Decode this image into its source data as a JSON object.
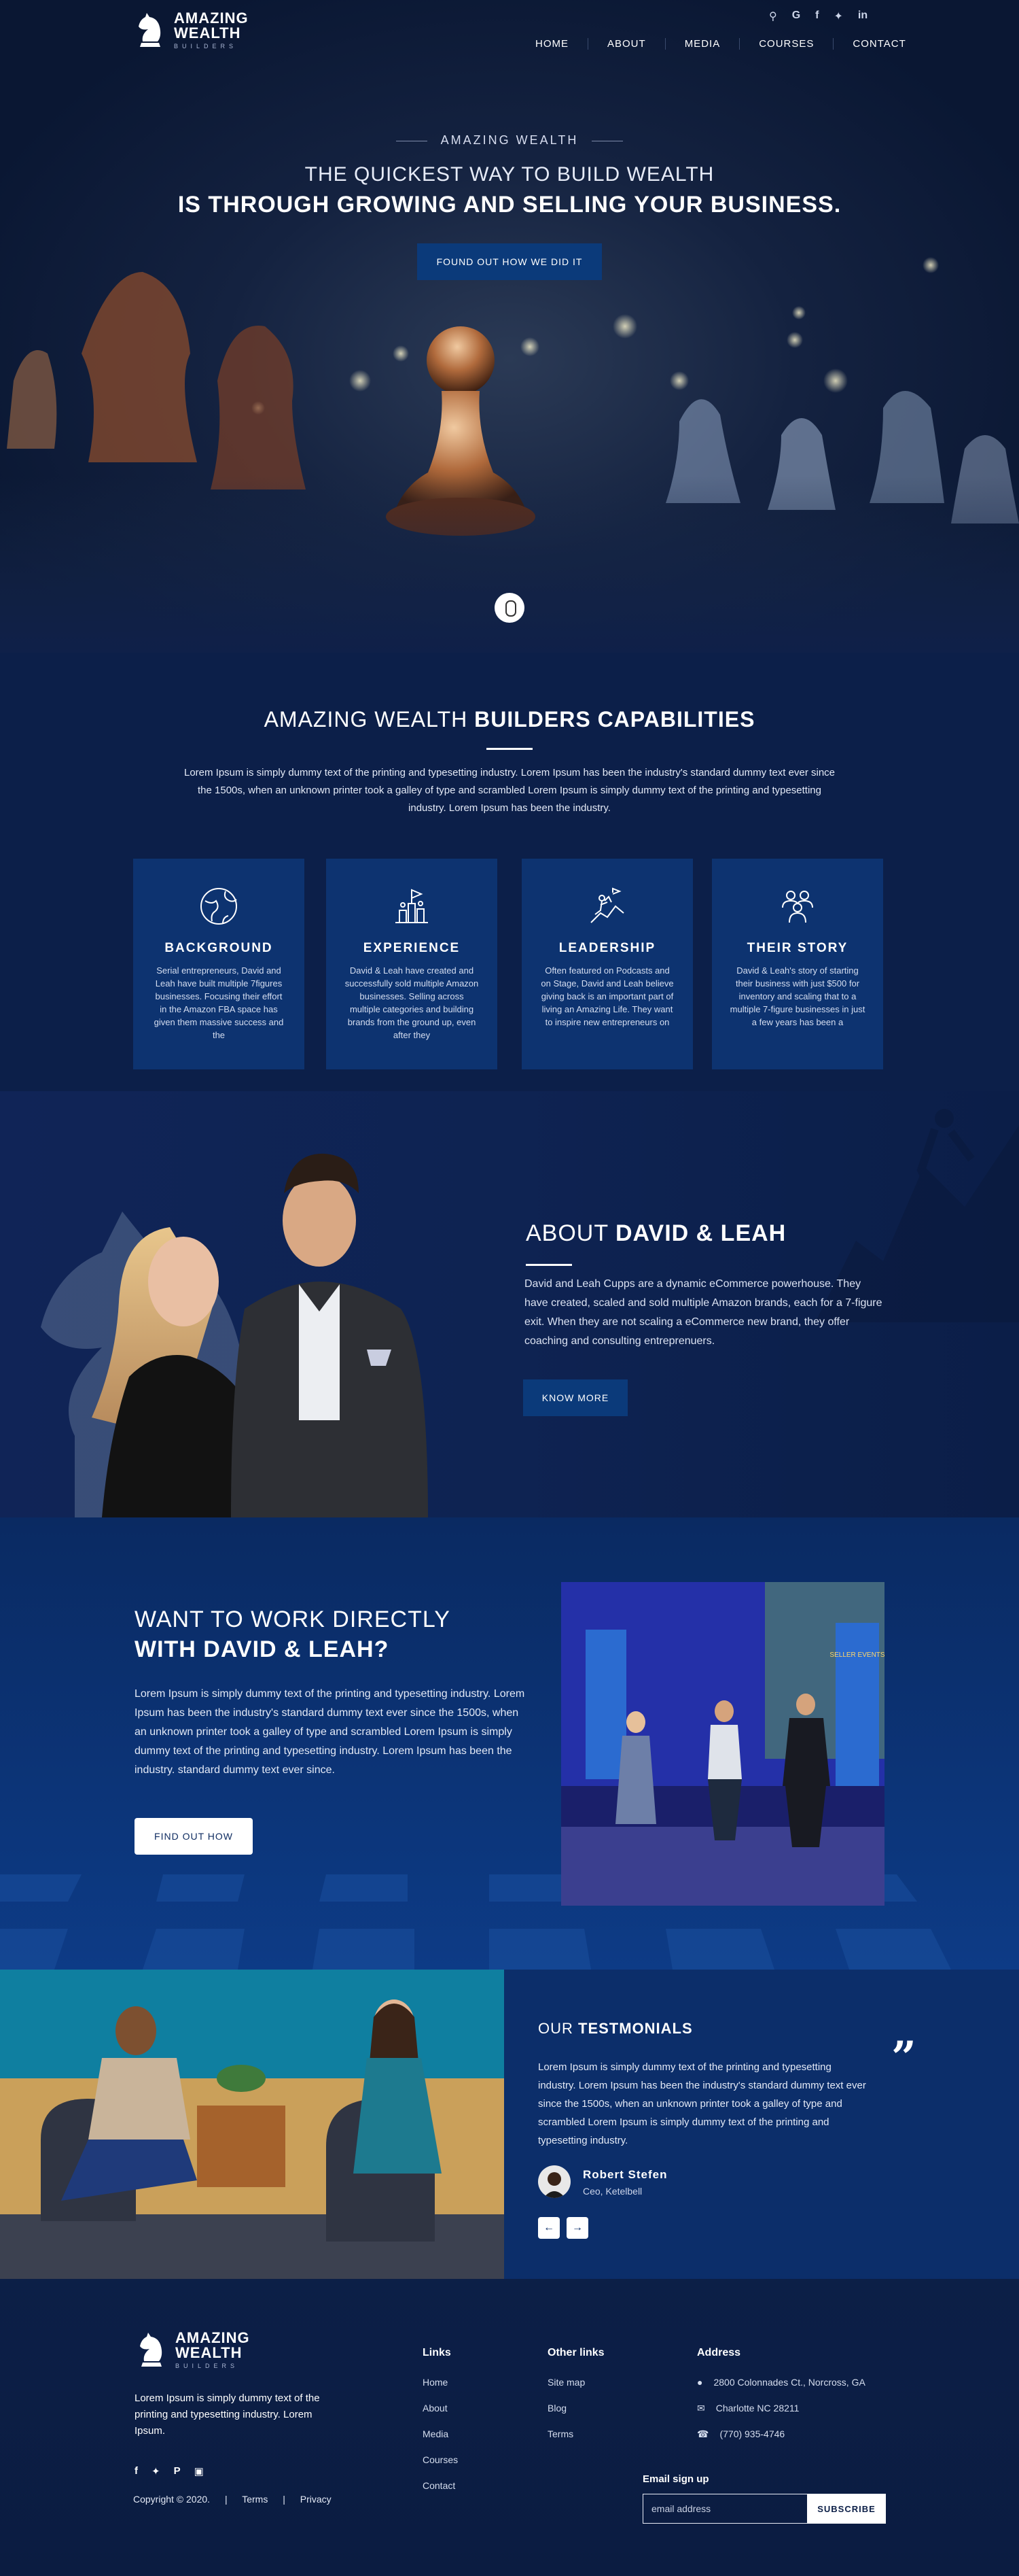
{
  "brand": {
    "line1": "AMAZING",
    "line2": "WEALTH",
    "line3": "BUILDERS"
  },
  "top_icons": [
    "search-icon",
    "google-icon",
    "facebook-icon",
    "twitter-icon",
    "linkedin-icon"
  ],
  "nav": [
    "HOME",
    "ABOUT",
    "MEDIA",
    "COURSES",
    "CONTACT"
  ],
  "hero": {
    "eyebrow": "AMAZING WEALTH",
    "line1": "THE QUICKEST WAY TO BUILD WEALTH",
    "line2": "IS THROUGH GROWING AND SELLING YOUR BUSINESS.",
    "cta": "FOUND OUT HOW WE DID IT"
  },
  "capabilities": {
    "title_light": "AMAZING WEALTH ",
    "title_bold": "BUILDERS CAPABILITIES",
    "lead": "Lorem Ipsum is simply dummy text of the printing and typesetting industry. Lorem Ipsum has been the industry's standard dummy text ever since the 1500s, when an unknown printer took a galley of type and scrambled Lorem Ipsum is simply dummy text of the printing and typesetting industry. Lorem Ipsum has been the industry.",
    "cards": [
      {
        "icon": "globe-icon",
        "title": "BACKGROUND",
        "text": "Serial entrepreneurs, David and Leah have built multiple 7figures businesses. Focusing their effort in the Amazon FBA space has given them massive success and the"
      },
      {
        "icon": "goal-flag-icon",
        "title": "EXPERIENCE",
        "text": "David & Leah have created and successfully sold multiple Amazon businesses. Selling across multiple categories and building brands from the ground up, even after they"
      },
      {
        "icon": "climber-icon",
        "title": "LEADERSHIP",
        "text": "Often featured on Podcasts and on Stage, David and Leah believe giving back is an important part of living an Amazing Life. They want to inspire new entrepreneurs on"
      },
      {
        "icon": "team-icon",
        "title": "THEIR STORY",
        "text": "David & Leah's story of starting their business with just $500 for inventory and scaling that to a multiple 7-figure businesses in just a few years has been a"
      }
    ]
  },
  "about": {
    "title_light": "ABOUT ",
    "title_bold": "DAVID & LEAH",
    "text": "David and Leah Cupps are a dynamic eCommerce powerhouse. They have created, scaled and sold multiple Amazon brands, each for a 7-figure exit. When they are not scaling a eCommerce new brand, they offer coaching and consulting entreprenuers.",
    "button": "KNOW MORE"
  },
  "work": {
    "title_line1": "WANT TO WORK DIRECTLY",
    "title_line2": "WITH DAVID & LEAH?",
    "text": "Lorem Ipsum is simply dummy text of the printing and typesetting industry. Lorem Ipsum has been the industry's standard dummy text ever since the 1500s, when an unknown printer took a galley of type and scrambled Lorem Ipsum is simply dummy text of the printing and typesetting industry. Lorem Ipsum has been the industry. standard dummy text ever since.",
    "button": "FIND OUT HOW",
    "photo_banner": "SELLER EVENTS"
  },
  "testimonials": {
    "title_light": "OUR ",
    "title_bold": "TESTMONIALS",
    "text": "Lorem Ipsum is simply dummy text of the printing and typesetting industry. Lorem Ipsum has been the industry's standard dummy text ever since the 1500s, when an unknown printer took a galley of type and scrambled Lorem Ipsum is simply dummy text of the printing and typesetting industry.",
    "quote_mark": "”",
    "name": "Robert Stefen",
    "role": "Ceo, Ketelbell",
    "prev": "←",
    "next": "→"
  },
  "footer": {
    "description": "Lorem Ipsum is simply dummy text of the printing and typesetting industry. Lorem Ipsum.",
    "social_icons": [
      "facebook-icon",
      "twitter-icon",
      "pinterest-icon",
      "instagram-icon"
    ],
    "copyright": "Copyright © 2020.",
    "sep": "|",
    "terms": "Terms",
    "privacy": "Privacy",
    "links_title": "Links",
    "links": [
      "Home",
      "About",
      "Media",
      "Courses",
      "Contact"
    ],
    "other_title": "Other links",
    "other_links": [
      "Site map",
      "Blog",
      "Terms"
    ],
    "address_title": "Address",
    "address": [
      {
        "icon": "location-pin-icon",
        "text": "2800 Colonnades Ct., Norcross, GA"
      },
      {
        "icon": "mail-icon",
        "text": "Charlotte NC 28211"
      },
      {
        "icon": "phone-icon",
        "text": "(770) 935-4746"
      }
    ],
    "email_label": "Email sign up",
    "email_placeholder": "email address",
    "subscribe": "SUBSCRIBE"
  },
  "colors": {
    "navy": "#0b1a3d",
    "card_blue": "#0d3370",
    "button_blue": "#0b3a7a",
    "white": "#ffffff"
  }
}
